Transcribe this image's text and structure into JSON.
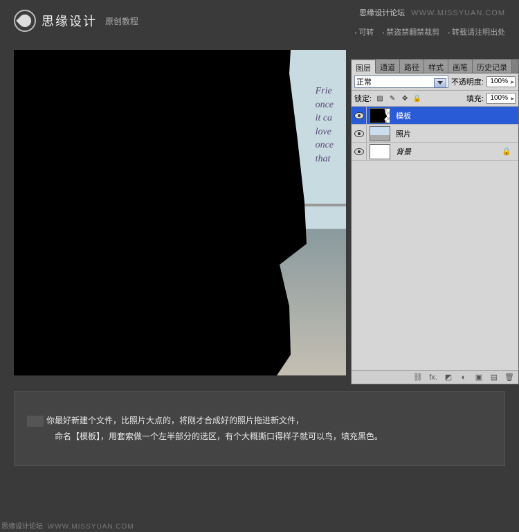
{
  "header": {
    "logo_text": "思缘设计",
    "logo_sub": "原创教程",
    "watermark_title": "思缘设计论坛",
    "watermark_url": "WWW.MISSYUAN.COM",
    "rules": [
      "可转",
      "禁盗禁翻禁裁剪",
      "转载请注明出处"
    ]
  },
  "canvas": {
    "script_lines": [
      "Frie",
      "once",
      "it ca",
      "love",
      "once",
      "that"
    ]
  },
  "panel": {
    "tabs": [
      "图层",
      "通道",
      "路径",
      "样式",
      "画笔",
      "历史记录"
    ],
    "active_tab": 0,
    "blend_mode": "正常",
    "opacity_label": "不透明度:",
    "opacity_value": "100%",
    "lock_label": "锁定:",
    "fill_label": "填充:",
    "fill_value": "100%",
    "layers": [
      {
        "name": "模板",
        "selected": true,
        "thumb": "shape"
      },
      {
        "name": "照片",
        "selected": false,
        "thumb": "photo"
      },
      {
        "name": "背景",
        "selected": false,
        "thumb": "white",
        "italic": true,
        "locked": true
      }
    ],
    "footer_icons": [
      "link",
      "fx",
      "mask",
      "adjust",
      "folder",
      "new",
      "trash"
    ]
  },
  "caption": {
    "line1_a": "你最好新建个文件，比照片大点的，将刚才合成好的照片拖进新文件，",
    "line2": "命名【模板】，用套索做一个左半部分的选区，有个大概撕口得样子就可以鸟，填充黑色。"
  },
  "footer": {
    "title": "思缘设计论坛",
    "url": "WWW.MISSYUAN.COM"
  }
}
